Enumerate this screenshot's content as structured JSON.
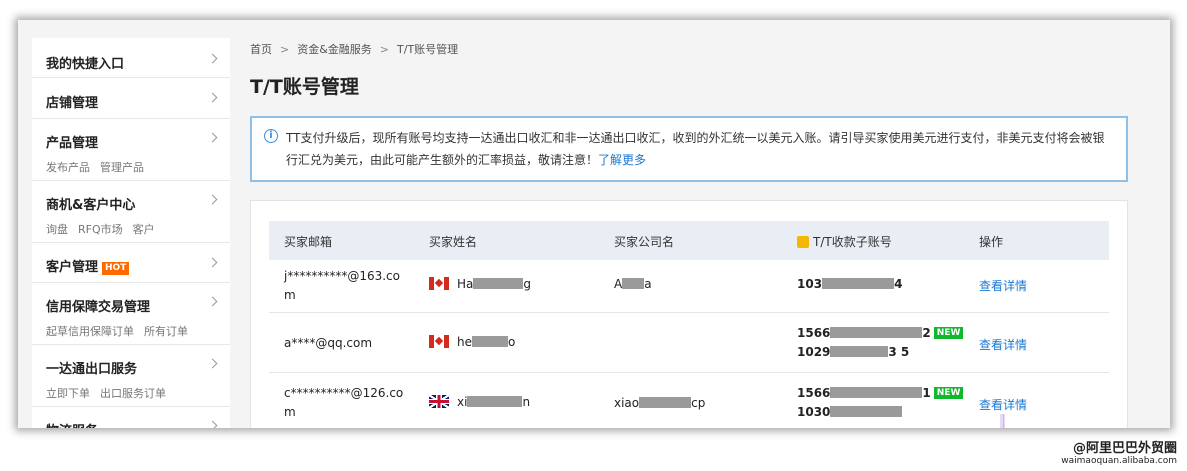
{
  "sidebar": {
    "items": [
      {
        "label": "我的快捷入口",
        "subs": []
      },
      {
        "label": "店铺管理",
        "subs": []
      },
      {
        "label": "产品管理",
        "subs": [
          "发布产品",
          "管理产品"
        ]
      },
      {
        "label": "商机&客户中心",
        "subs": [
          "询盘",
          "RFQ市场",
          "客户"
        ]
      },
      {
        "label": "客户管理",
        "badge": "HOT",
        "subs": []
      },
      {
        "label": "信用保障交易管理",
        "subs": [
          "起草信用保障订单",
          "所有订单"
        ]
      },
      {
        "label": "一达通出口服务",
        "subs": [
          "立即下单",
          "出口服务订单"
        ]
      },
      {
        "label": "物流服务",
        "subs": []
      }
    ]
  },
  "breadcrumb": [
    "首页",
    "资金&金融服务",
    "T/T账号管理"
  ],
  "page_title": "T/T账号管理",
  "notice": {
    "text": "TT支付升级后，现所有账号均支持一达通出口收汇和非一达通出口收汇，收到的外汇统一以美元入账。请引导买家使用美元进行支付，非美元支付将会被银行汇兑为美元，由此可能产生额外的汇率损益，敬请注意！",
    "link": "了解更多"
  },
  "table": {
    "headers": [
      "买家邮箱",
      "买家姓名",
      "买家公司名",
      "T/T收款子账号",
      "操作"
    ],
    "rows": [
      {
        "email": "j**********@163.com",
        "flag": "CA",
        "name_prefix": "Ha",
        "name_suffix": "g",
        "company_prefix": "A",
        "company_suffix": "a",
        "accounts": [
          {
            "prefix": "103",
            "suffix": "4",
            "new": false
          }
        ],
        "action": "查看详情"
      },
      {
        "email": "a****@qq.com",
        "flag": "CA",
        "name_prefix": "he",
        "name_suffix": "o",
        "company_prefix": "",
        "company_suffix": "",
        "accounts": [
          {
            "prefix": "1566",
            "suffix": "2",
            "new": true
          },
          {
            "prefix": "1029",
            "suffix": "3 5",
            "new": false
          }
        ],
        "action": "查看详情"
      },
      {
        "email": "c**********@126.com",
        "flag": "UK",
        "name_prefix": "xi",
        "name_suffix": "n",
        "company_prefix": "xiao",
        "company_suffix": "cp",
        "accounts": [
          {
            "prefix": "1566",
            "suffix": "1",
            "new": true
          },
          {
            "prefix": "1030",
            "suffix": "",
            "new": false
          }
        ],
        "action": "查看详情"
      }
    ],
    "new_badge": "NEW"
  },
  "watermark": {
    "line1": "@阿里巴巴外贸圈",
    "line2": "waimaoquan.alibaba.com"
  }
}
